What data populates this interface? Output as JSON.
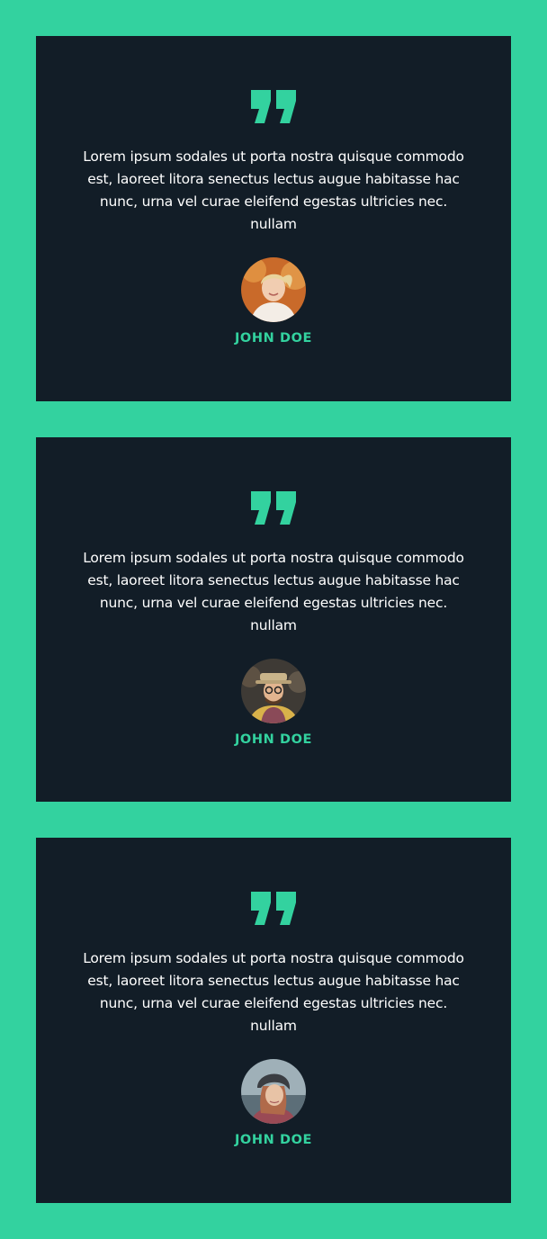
{
  "colors": {
    "page_background": "#33d29f",
    "card_background": "#121d27",
    "accent": "#33d29f",
    "text": "#ffffff"
  },
  "testimonials": [
    {
      "quote": "Lorem ipsum sodales ut porta nostra quisque commodo est, laoreet litora senectus lectus augue habitasse hac nunc, urna vel curae eleifend egestas ultricies nec. nullam",
      "name": "JOHN DOE",
      "icon": "quote-icon",
      "avatar": "avatar-woman-smiling-autumn"
    },
    {
      "quote": "Lorem ipsum sodales ut porta nostra quisque commodo est, laoreet litora senectus lectus augue habitasse hac nunc, urna vel curae eleifend egestas ultricies nec. nullam",
      "name": "JOHN DOE",
      "icon": "quote-icon",
      "avatar": "avatar-man-hat-glasses"
    },
    {
      "quote": "Lorem ipsum sodales ut porta nostra quisque commodo est, laoreet litora senectus lectus augue habitasse hac nunc, urna vel curae eleifend egestas ultricies nec. nullam",
      "name": "JOHN DOE",
      "icon": "quote-icon",
      "avatar": "avatar-woman-beanie"
    }
  ]
}
